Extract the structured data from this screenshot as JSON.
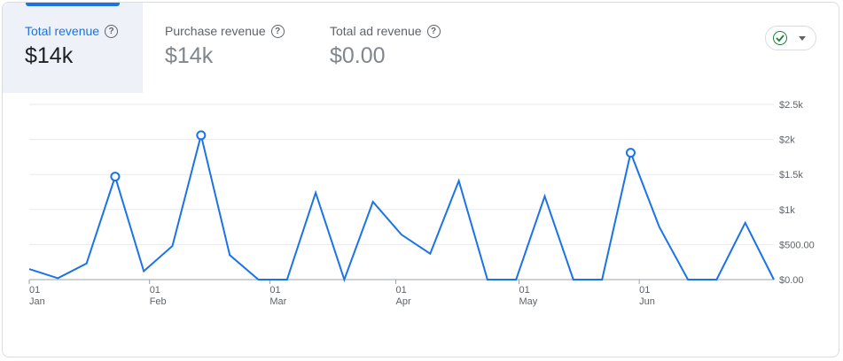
{
  "metrics": [
    {
      "label": "Total revenue",
      "value": "$14k",
      "active": true
    },
    {
      "label": "Purchase revenue",
      "value": "$14k",
      "active": false
    },
    {
      "label": "Total ad revenue",
      "value": "$0.00",
      "active": false
    }
  ],
  "help_glyph": "?",
  "status": {
    "icon": "check-circle-icon",
    "color": "#188038"
  },
  "chart_data": {
    "type": "line",
    "series": [
      {
        "color": "#1a73e8",
        "values": [
          150,
          20,
          230,
          1470,
          120,
          480,
          2060,
          350,
          0,
          0,
          1240,
          0,
          1110,
          640,
          370,
          1410,
          0,
          0,
          1190,
          0,
          0,
          1810,
          750,
          0,
          0,
          810,
          0
        ]
      }
    ],
    "anomalies": [
      3,
      6,
      21
    ],
    "ylim": [
      0,
      2500
    ],
    "yticks": [
      {
        "v": 0,
        "label": "$0.00"
      },
      {
        "v": 500,
        "label": "$500.00"
      },
      {
        "v": 1000,
        "label": "$1k"
      },
      {
        "v": 1500,
        "label": "$1.5k"
      },
      {
        "v": 2000,
        "label": "$2k"
      },
      {
        "v": 2500,
        "label": "$2.5k"
      }
    ],
    "xticks": [
      {
        "i": 0,
        "day": "01",
        "month": "Jan"
      },
      {
        "i": 4.2,
        "day": "01",
        "month": "Feb"
      },
      {
        "i": 8.4,
        "day": "01",
        "month": "Mar"
      },
      {
        "i": 12.8,
        "day": "01",
        "month": "Apr"
      },
      {
        "i": 17.1,
        "day": "01",
        "month": "May"
      },
      {
        "i": 21.3,
        "day": "01",
        "month": "Jun"
      }
    ],
    "grid": true
  }
}
